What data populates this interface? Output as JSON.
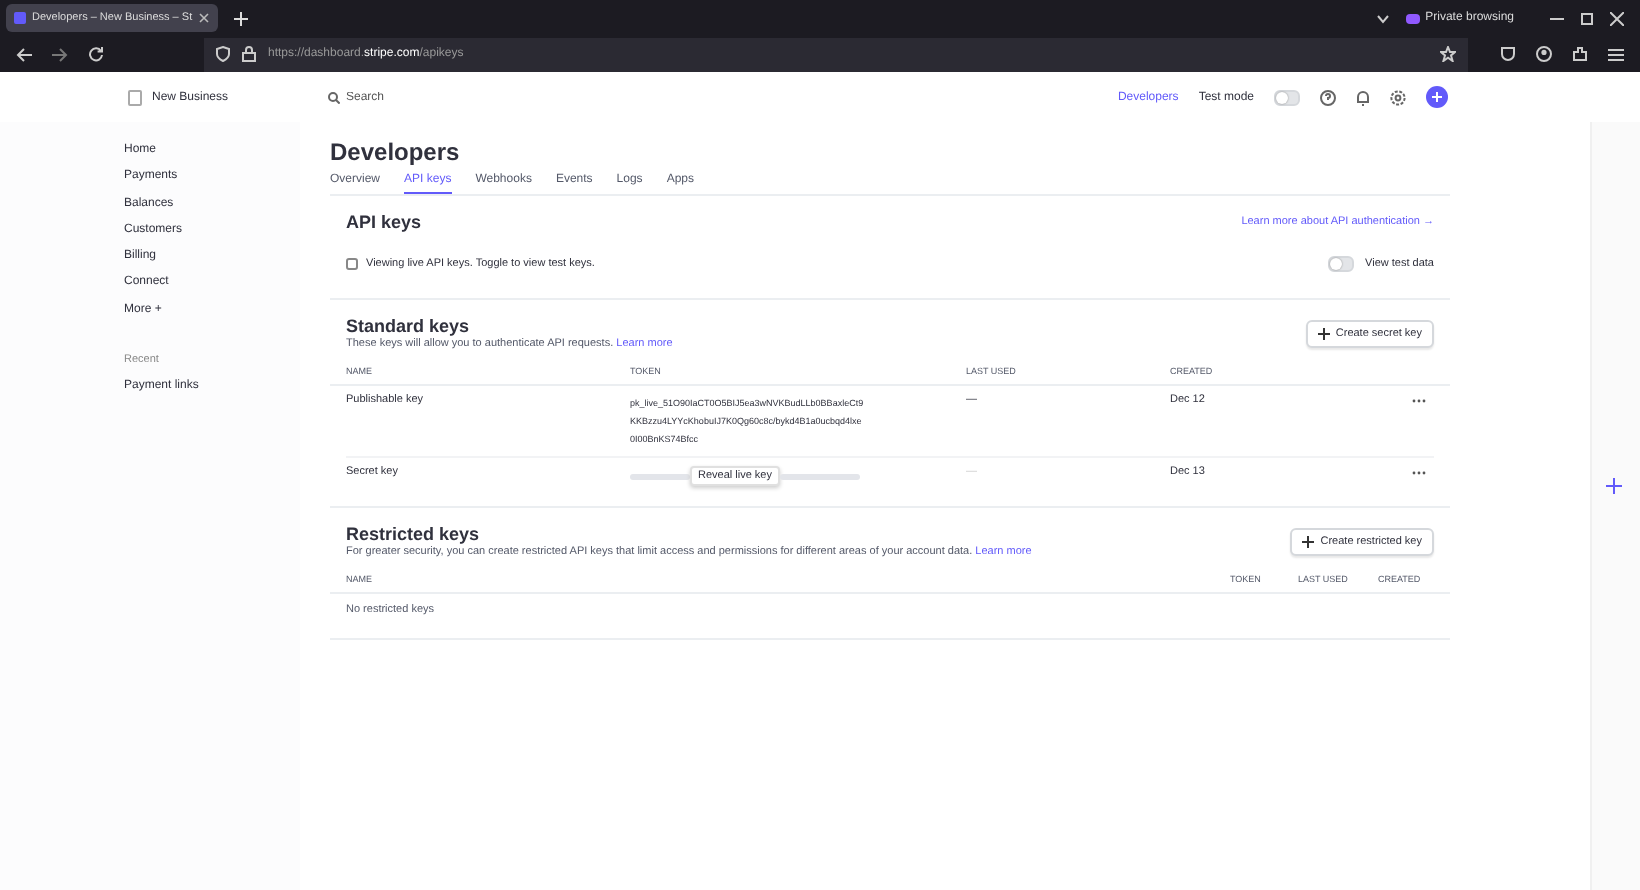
{
  "browser": {
    "tab_title": "Developers – New Business – St",
    "url_prefix": "https://dashboard.",
    "url_domain": "stripe.com",
    "url_path": "/apikeys",
    "private_label": "Private browsing"
  },
  "header": {
    "account": "New Business",
    "search_placeholder": "Search",
    "developers_link": "Developers",
    "test_mode": {
      "label": "Test mode",
      "on": false
    }
  },
  "sidebar": {
    "items": [
      {
        "label": "Home",
        "selected": false
      },
      {
        "label": "Payments",
        "selected": false
      },
      {
        "label": "Balances",
        "selected": false
      },
      {
        "label": "Customers",
        "selected": false
      },
      {
        "label": "Billing",
        "selected": false
      },
      {
        "label": "Connect",
        "selected": false
      },
      {
        "label": "More +",
        "selected": false
      }
    ],
    "recent_heading": "Recent",
    "recent_items": [
      "Payment links"
    ]
  },
  "page": {
    "title": "Developers",
    "tabs": [
      {
        "label": "Overview",
        "selected": false
      },
      {
        "label": "API keys",
        "selected": true
      },
      {
        "label": "Webhooks",
        "selected": false
      },
      {
        "label": "Events",
        "selected": false
      },
      {
        "label": "Logs",
        "selected": false
      },
      {
        "label": "Apps",
        "selected": false
      }
    ]
  },
  "api_keys": {
    "title": "API keys",
    "link": "Learn more about API authentication →",
    "notice": "Viewing live API keys. Toggle to view test keys.",
    "toggle": {
      "label": "View test data",
      "on": false
    }
  },
  "standard_keys": {
    "title": "Standard keys",
    "description": "These keys will allow you to authenticate API requests.",
    "link": "Learn more",
    "button": "Create secret key",
    "columns": [
      "NAME",
      "TOKEN",
      "LAST USED",
      "CREATED"
    ],
    "rows": [
      {
        "kind": "visible",
        "name": "Publishable key",
        "token_lines": [
          "pk_live_51O90IaCT0O5BIJ5ea3wNVKBudLLb0BBaxleCt9",
          "KKBzzu4LYYcKhobuIJ7K0Qg60c8c/bykd4B1a0ucbqd4lxe",
          "0I00BnKS74Bfcc"
        ],
        "last_used": "—",
        "created": "Dec 12"
      },
      {
        "kind": "masked",
        "name": "Secret key",
        "reveal": "Reveal live key",
        "last_used": "—",
        "created": "Dec 13"
      }
    ]
  },
  "restricted_keys": {
    "title": "Restricted keys",
    "description": "For greater security, you can create restricted API keys that limit access and permissions for different areas of your account data.",
    "link": "Learn more",
    "button": "Create restricted key",
    "columns": [
      "NAME",
      "TOKEN",
      "LAST USED",
      "CREATED"
    ],
    "empty": "No restricted keys"
  }
}
